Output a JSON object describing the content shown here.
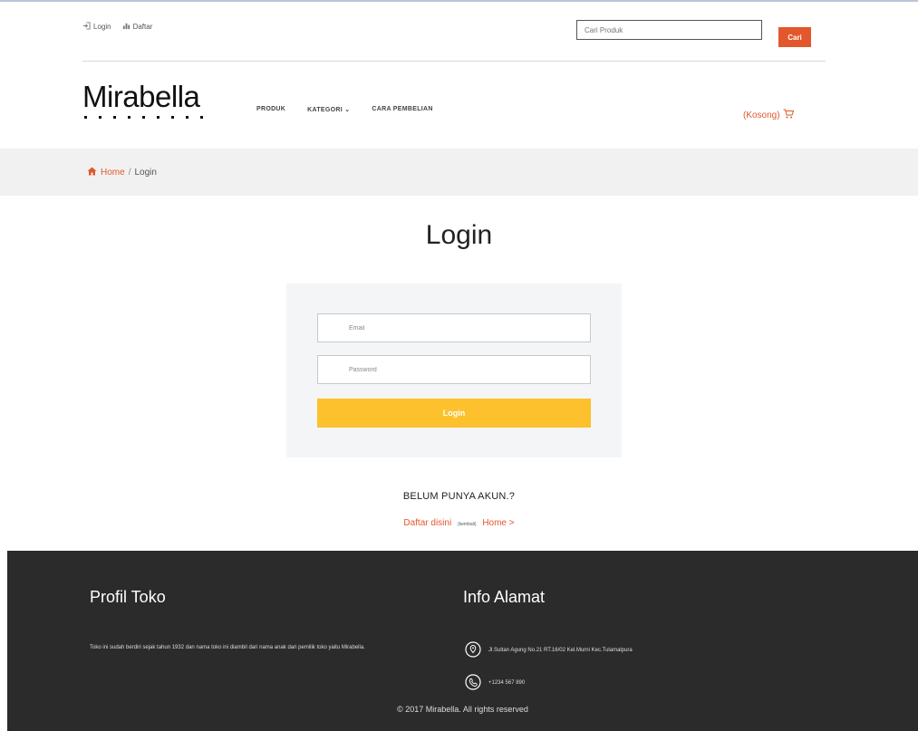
{
  "topbar": {
    "login_label": "Login",
    "register_label": "Daftar",
    "search_placeholder": "Cari Produk",
    "search_button": "Cari"
  },
  "brand": {
    "logo": "Mirabella"
  },
  "nav": {
    "items": [
      {
        "label": "PRODUK"
      },
      {
        "label": "KATEGORI"
      },
      {
        "label": "CARA PEMBELIAN"
      }
    ]
  },
  "cart": {
    "label": "(Kosong)"
  },
  "breadcrumb": {
    "home": "Home",
    "separator": "/",
    "current": "Login"
  },
  "page": {
    "title": "Login"
  },
  "login_form": {
    "email_placeholder": "Email",
    "password_placeholder": "Password",
    "submit_label": "Login"
  },
  "register_prompt": {
    "question": "BELUM PUNYA AKUN.?",
    "register_link": "Daftar disini",
    "or_text": "(kembali)",
    "home_link": "Home >"
  },
  "footer": {
    "profile_title": "Profil Toko",
    "profile_text": "Toko ini sudah berdiri sejak tahun 1932 dan nama toko ini diambil dari nama anak dari pemilik toko yaitu Mirabella.",
    "address_title": "Info Alamat",
    "address": "Jl.Sultan Agung No.21 RT.16/02 Kel.Murni Kec.Tulamalpura",
    "phone": "+1234 567 890",
    "copyright": "© 2017 Mirabella. All rights reserved"
  },
  "colors": {
    "accent": "#e2572b",
    "login_button": "#fcc12c",
    "footer_bg": "#2b2b2b",
    "breadcrumb_bg": "#f1f1f1"
  }
}
